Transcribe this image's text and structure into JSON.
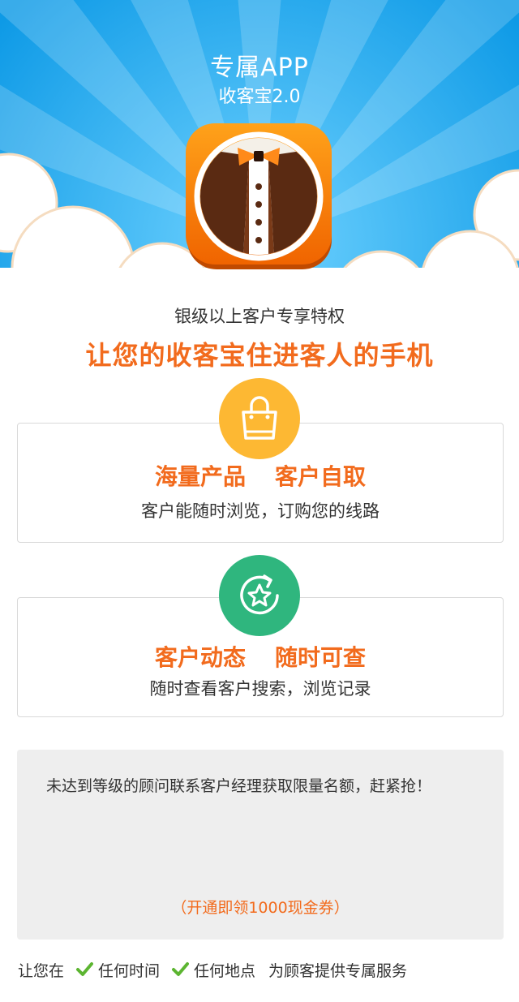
{
  "hero": {
    "title": "专属APP",
    "subtitle": "收客宝2.0",
    "app_icon": "tuxedo-app-icon"
  },
  "intro": {
    "subhead": "银级以上客户专享特权",
    "headline": "让您的收客宝住进客人的手机"
  },
  "features": [
    {
      "icon": "shopping-bag-icon",
      "title_left": "海量产品",
      "title_right": "客户自取",
      "desc": "客户能随时浏览，订购您的线路"
    },
    {
      "icon": "refresh-star-icon",
      "title_left": "客户动态",
      "title_right": "随时可查",
      "desc": "随时查看客户搜索，浏览记录"
    }
  ],
  "notice": {
    "text": "未达到等级的顾问联系客户经理获取限量名额，赶紧抢！",
    "offer": "（开通即领1000现金券）"
  },
  "footer": {
    "prefix": "让您在",
    "item1": "任何时间",
    "item2": "任何地点",
    "suffix": "为顾客提供专属服务"
  },
  "colors": {
    "sky": "#1aa9f0",
    "accent": "#f26b1d",
    "badge_orange": "#fdb833",
    "badge_green": "#2fb67e",
    "check": "#5cb531"
  }
}
